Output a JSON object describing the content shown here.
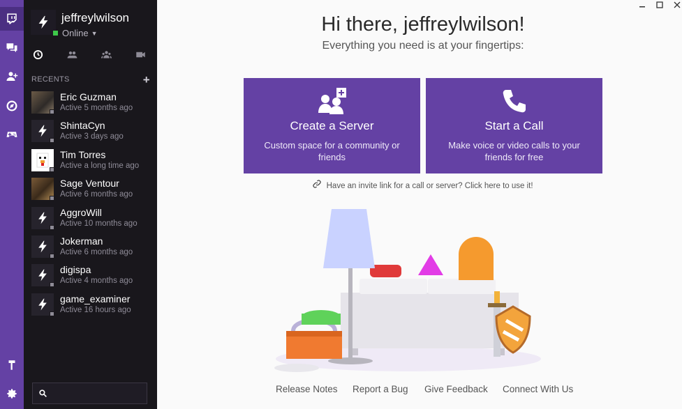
{
  "user": {
    "name": "jeffreylwilson",
    "status": "Online"
  },
  "recents": {
    "heading": "RECENTS",
    "add_symbol": "+",
    "friends": [
      {
        "name": "Eric Guzman",
        "active": "Active 5 months ago",
        "avatar": "photo"
      },
      {
        "name": "ShintaCyn",
        "active": "Active 3 days ago",
        "avatar": "default"
      },
      {
        "name": "Tim Torres",
        "active": "Active a long time ago",
        "avatar": "chicken"
      },
      {
        "name": "Sage Ventour",
        "active": "Active 6 months ago",
        "avatar": "photo"
      },
      {
        "name": "AggroWill",
        "active": "Active 10 months ago",
        "avatar": "default"
      },
      {
        "name": "Jokerman",
        "active": "Active 6 months ago",
        "avatar": "default"
      },
      {
        "name": "digispa",
        "active": "Active 4 months ago",
        "avatar": "default"
      },
      {
        "name": "game_examiner",
        "active": "Active 16 hours ago",
        "avatar": "default"
      }
    ]
  },
  "search": {
    "placeholder": ""
  },
  "rail": {
    "items": [
      "twitch-logo-icon",
      "whispers-icon",
      "add-friend-icon",
      "browse-icon",
      "games-icon",
      "mod-icon",
      "settings-icon"
    ]
  },
  "filters": [
    "recent-icon",
    "friends-icon",
    "groups-icon",
    "video-icon"
  ],
  "main": {
    "greeting": "Hi there, jeffreylwilson!",
    "subtitle": "Everything you need is at your fingertips:",
    "cards": [
      {
        "title": "Create a Server",
        "desc": "Custom space for a community or friends",
        "icon": "server-add-icon"
      },
      {
        "title": "Start a Call",
        "desc": "Make voice or video calls to your friends for free",
        "icon": "phone-icon"
      }
    ],
    "invite": "Have an invite link for a call or server? Click here to use it!",
    "footer": [
      "Release Notes",
      "Report a Bug",
      "Give Feedback",
      "Connect With Us"
    ]
  },
  "colors": {
    "accent": "#6441a4",
    "panel": "#19171c",
    "online": "#3ec94a",
    "background": "#fafafa"
  }
}
